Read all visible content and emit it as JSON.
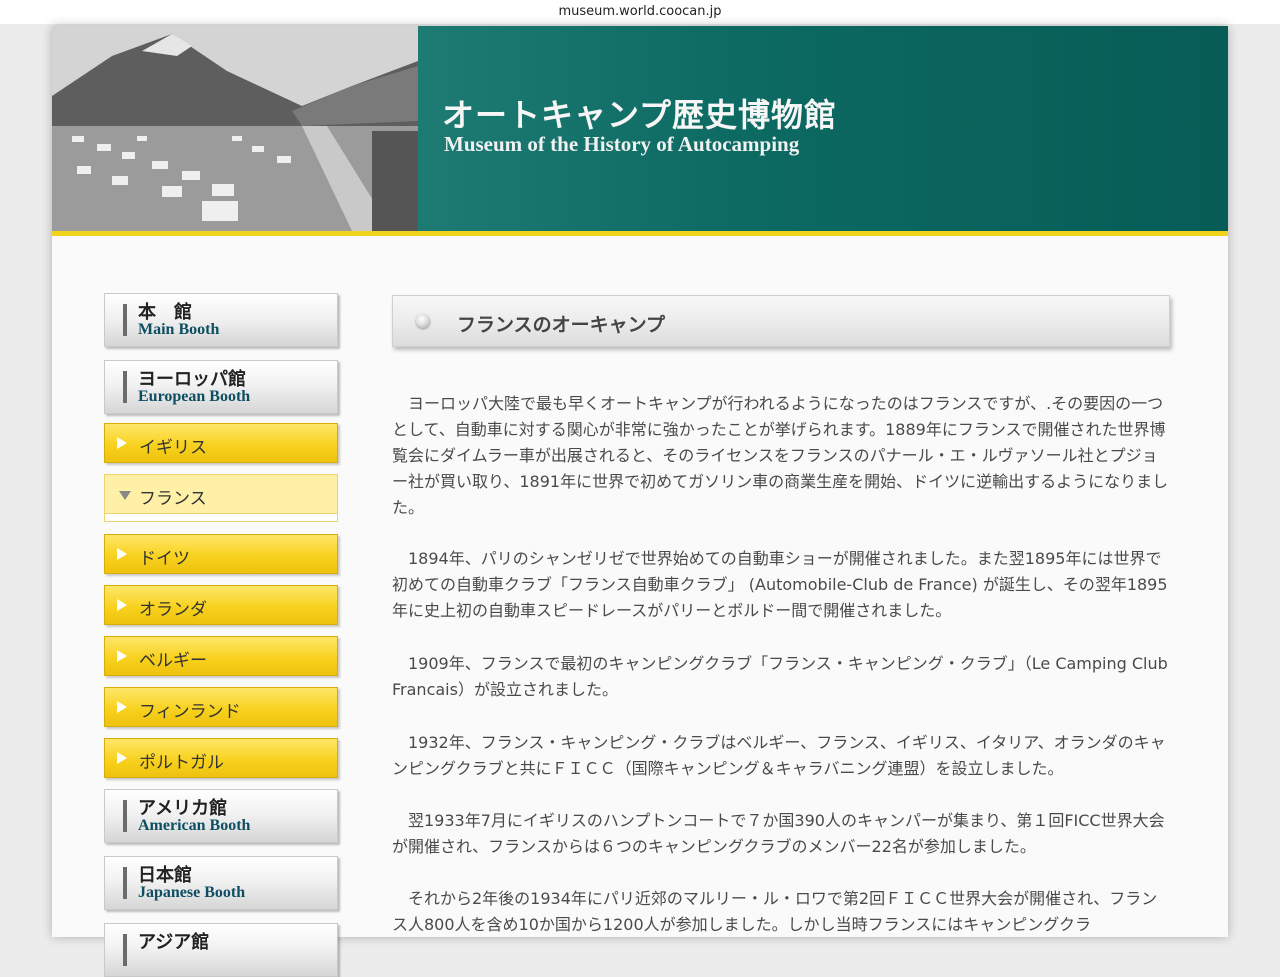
{
  "browser": {
    "url": "museum.world.coocan.jp"
  },
  "header": {
    "title_ja": "オートキャンプ歴史博物館",
    "title_en": "Museum of the History of Autocamping"
  },
  "sidebar": {
    "main_booth": {
      "ja": "本　館",
      "en": "Main Booth"
    },
    "european_booth": {
      "ja": "ヨーロッパ館",
      "en": "European Booth"
    },
    "countries": [
      {
        "label": "イギリス"
      },
      {
        "label": "フランス",
        "active": true
      },
      {
        "label": "ドイツ"
      },
      {
        "label": "オランダ"
      },
      {
        "label": "ベルギー"
      },
      {
        "label": "フィンランド"
      },
      {
        "label": "ポルトガル"
      }
    ],
    "american_booth": {
      "ja": "アメリカ館",
      "en": "American Booth"
    },
    "japanese_booth": {
      "ja": "日本館",
      "en": "Japanese Booth"
    },
    "asia_booth": {
      "ja": "アジア館"
    }
  },
  "content": {
    "heading": "フランスのオーキャンプ",
    "paragraphs": [
      "ヨーロッパ大陸で最も早くオートキャンプが行われるようになったのはフランスですが、.その要因の一つとして、自動車に対する関心が非常に強かったことが挙げられます。1889年にフランスで開催された世界博覧会にダイムラー車が出展されると、そのライセンスをフランスのパナール・エ・ルヴァソール社とプジョー社が買い取り、1891年に世界で初めてガソリン車の商業生産を開始、ドイツに逆輸出するようになりました。",
      "1894年、パリのシャンゼリゼで世界始めての自動車ショーが開催されました。また翌1895年には世界で初めての自動車クラブ「フランス自動車クラブ」 (Automobile-Club de France) が誕生し、その翌年1895年に史上初の自動車スピードレースがパリーとボルドー間で開催されました。",
      "1909年、フランスで最初のキャンピングクラブ「フランス・キャンピング・クラブ」（Le Camping Club Francais）が設立されました。",
      "1932年、フランス・キャンピング・クラブはベルギー、フランス、イギリス、イタリア、オランダのキャンピングクラブと共にＦＩＣＣ（国際キャンピング＆キャラバニング連盟）を設立しました。",
      "翌1933年7月にイギリスのハンプトンコートで７か国390人のキャンパーが集まり、第１回FICC世界大会が開催され、フランスからは６つのキャンピングクラブのメンバー22名が参加しました。",
      "それから2年後の1934年にパリ近郊のマルリー・ル・ロワで第2回ＦＩＣＣ世界大会が開催され、フランス人800人を含め10か国から1200人が参加しました。しかし当時フランスにはキャンピングクラ"
    ]
  }
}
